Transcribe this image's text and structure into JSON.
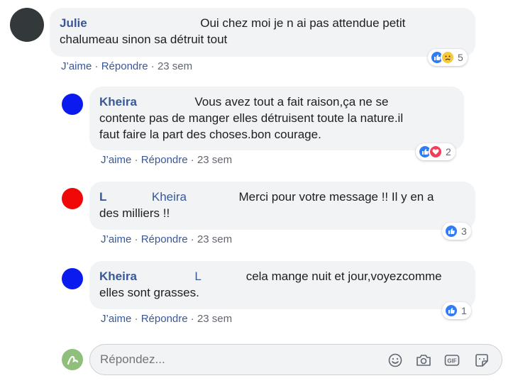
{
  "comments": [
    {
      "author": "Julie",
      "mention": "",
      "text_lines": [
        "Oui chez moi je n ai pas attendue petit",
        "chalumeau sinon sa détruit tout"
      ],
      "like_label": "J’aime",
      "reply_label": "Répondre",
      "time": "23 sem",
      "reaction_count": "5",
      "reactions": [
        "like",
        "sad"
      ],
      "avatar_color": "#33383a"
    },
    {
      "author": "Kheira",
      "mention": "",
      "text_lines": [
        "Vous avez tout a fait raison,ça ne se",
        "contente pas de manger elles détruisent toute la nature.il",
        "faut faire la part des choses.bon courage."
      ],
      "like_label": "J’aime",
      "reply_label": "Répondre",
      "time": "23 sem",
      "reaction_count": "2",
      "reactions": [
        "like",
        "love"
      ],
      "avatar_color": "#0b1bef"
    },
    {
      "author": "L",
      "mention": "Kheira",
      "text_lines": [
        "Merci pour votre message !! Il y en a",
        "des milliers !!"
      ],
      "like_label": "J’aime",
      "reply_label": "Répondre",
      "time": "23 sem",
      "reaction_count": "3",
      "reactions": [
        "like"
      ],
      "avatar_color": "#f00808"
    },
    {
      "author": "Kheira",
      "mention": "L",
      "text_lines": [
        "cela mange nuit et jour,voyezcomme",
        "elles sont grasses."
      ],
      "like_label": "J’aime",
      "reply_label": "Répondre",
      "time": "23 sem",
      "reaction_count": "1",
      "reactions": [
        "like"
      ],
      "avatar_color": "#0b1bef"
    }
  ],
  "composer": {
    "placeholder": "Répondez...",
    "tools": [
      "emoji-icon",
      "camera-icon",
      "gif-icon",
      "sticker-icon"
    ]
  },
  "separator": "·"
}
